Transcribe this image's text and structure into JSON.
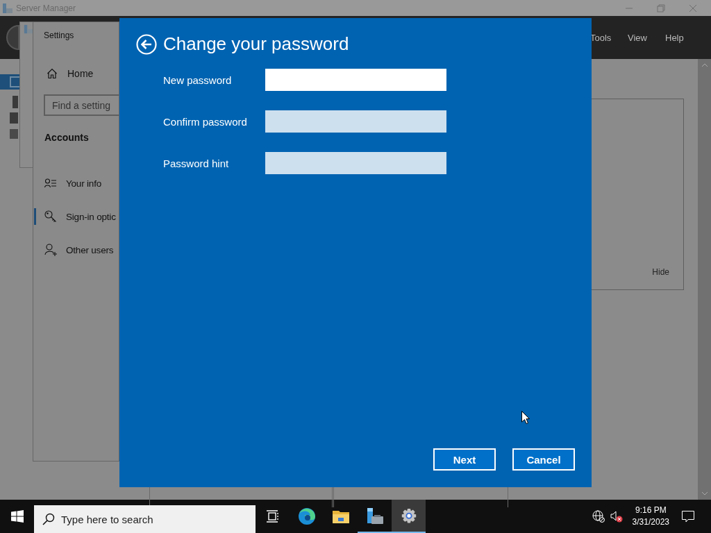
{
  "background_window": {
    "title": "Server Manager",
    "menu": [
      "Tools",
      "View",
      "Help"
    ],
    "panel": {
      "link": "Hide"
    }
  },
  "settings": {
    "title": "Settings",
    "home": "Home",
    "search": {
      "placeholder": "Find a setting"
    },
    "section": "Accounts",
    "nav": [
      {
        "label": "Your info",
        "kind": "person-list",
        "selected": false
      },
      {
        "label": "Sign-in optic",
        "kind": "key",
        "selected": true
      },
      {
        "label": "Other users",
        "kind": "person-add",
        "selected": false
      }
    ]
  },
  "dialog": {
    "title": "Change your password",
    "fields": [
      {
        "label": "New password",
        "focused": true
      },
      {
        "label": "Confirm password",
        "focused": false
      },
      {
        "label": "Password hint",
        "focused": false
      }
    ],
    "buttons": [
      "Next",
      "Cancel"
    ]
  },
  "taskbar": {
    "search": {
      "placeholder": "Type here to search"
    },
    "apps": [
      {
        "kind": "task-view",
        "active": false,
        "running": false
      },
      {
        "kind": "browser",
        "active": false,
        "running": false
      },
      {
        "kind": "folder",
        "active": false,
        "running": false
      },
      {
        "kind": "server",
        "active": false,
        "running": true
      },
      {
        "kind": "settings",
        "active": true,
        "running": true
      }
    ],
    "time": "9:16 PM",
    "date": "3/31/2023"
  }
}
